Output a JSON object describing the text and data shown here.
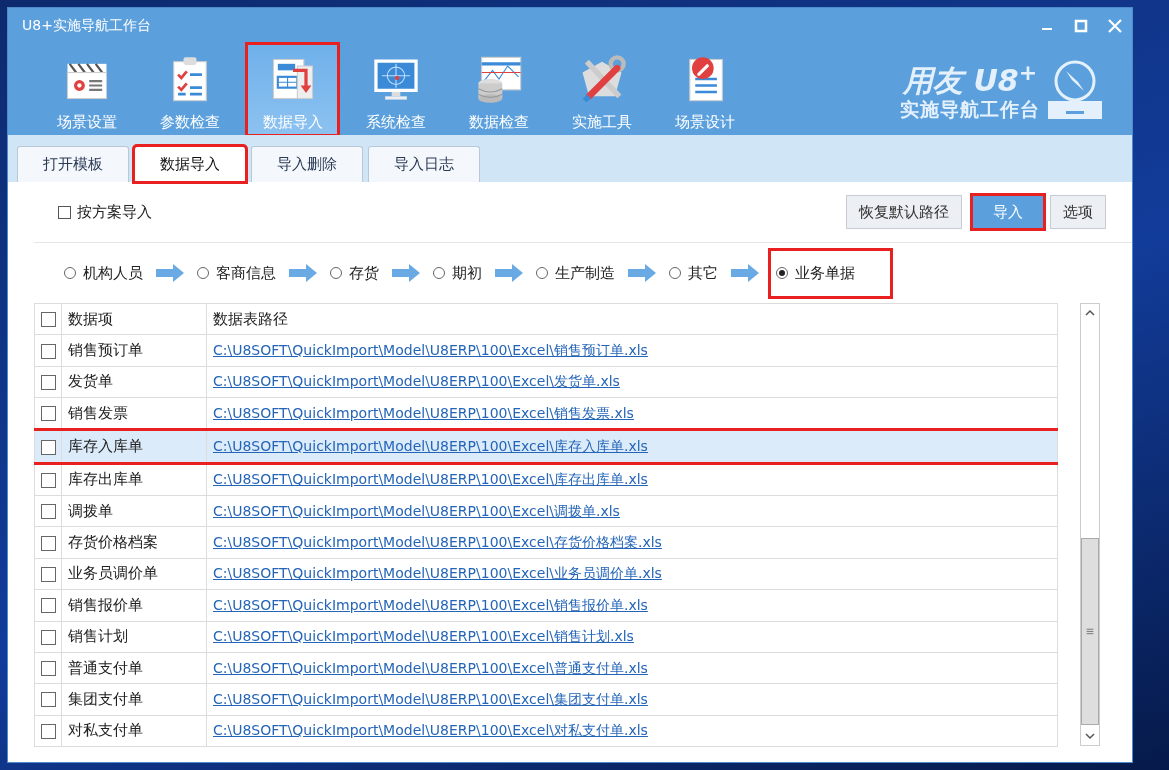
{
  "window": {
    "title": "U8+实施导航工作台"
  },
  "toolbar": [
    {
      "label": "场景设置",
      "selected": false,
      "marked": false
    },
    {
      "label": "参数检查",
      "selected": false,
      "marked": false
    },
    {
      "label": "数据导入",
      "selected": true,
      "marked": true
    },
    {
      "label": "系统检查",
      "selected": false,
      "marked": false
    },
    {
      "label": "数据检查",
      "selected": false,
      "marked": false
    },
    {
      "label": "实施工具",
      "selected": false,
      "marked": false
    },
    {
      "label": "场景设计",
      "selected": false,
      "marked": false
    }
  ],
  "logo": {
    "brand": "用友 U8$^{+}$",
    "subtitle": "实施导航工作台"
  },
  "tabs": [
    {
      "label": "打开模板",
      "selected": false,
      "marked": false
    },
    {
      "label": "数据导入",
      "selected": true,
      "marked": true
    },
    {
      "label": "导入删除",
      "selected": false,
      "marked": false
    },
    {
      "label": "导入日志",
      "selected": false,
      "marked": false
    }
  ],
  "scheme_import": {
    "label": "按方案导入",
    "checked": false
  },
  "buttons": [
    {
      "label": "恢复默认路径",
      "kind": "normal",
      "marked": false
    },
    {
      "label": "导入",
      "kind": "primary",
      "marked": true
    },
    {
      "label": "选项",
      "kind": "normal",
      "marked": false
    }
  ],
  "steps": [
    {
      "label": "机构人员",
      "selected": false,
      "marked": false
    },
    {
      "label": "客商信息",
      "selected": false,
      "marked": false
    },
    {
      "label": "存货",
      "selected": false,
      "marked": false
    },
    {
      "label": "期初",
      "selected": false,
      "marked": false
    },
    {
      "label": "生产制造",
      "selected": false,
      "marked": false
    },
    {
      "label": "其它",
      "selected": false,
      "marked": false
    },
    {
      "label": "业务单据",
      "selected": true,
      "marked": true
    }
  ],
  "table": {
    "columns": [
      "数据项",
      "数据表路径"
    ],
    "header_checked": false,
    "rows": [
      {
        "item": "销售预订单",
        "path": "C:\\U8SOFT\\QuickImport\\Model\\U8ERP\\100\\Excel\\销售预订单.xls",
        "checked": false,
        "selected": false,
        "marked": false
      },
      {
        "item": "发货单",
        "path": "C:\\U8SOFT\\QuickImport\\Model\\U8ERP\\100\\Excel\\发货单.xls",
        "checked": false,
        "selected": false,
        "marked": false
      },
      {
        "item": "销售发票",
        "path": "C:\\U8SOFT\\QuickImport\\Model\\U8ERP\\100\\Excel\\销售发票.xls",
        "checked": false,
        "selected": false,
        "marked": false
      },
      {
        "item": "库存入库单",
        "path": "C:\\U8SOFT\\QuickImport\\Model\\U8ERP\\100\\Excel\\库存入库单.xls",
        "checked": false,
        "selected": true,
        "marked": true
      },
      {
        "item": "库存出库单",
        "path": "C:\\U8SOFT\\QuickImport\\Model\\U8ERP\\100\\Excel\\库存出库单.xls",
        "checked": false,
        "selected": false,
        "marked": false
      },
      {
        "item": "调拨单",
        "path": "C:\\U8SOFT\\QuickImport\\Model\\U8ERP\\100\\Excel\\调拨单.xls",
        "checked": false,
        "selected": false,
        "marked": false
      },
      {
        "item": "存货价格档案",
        "path": "C:\\U8SOFT\\QuickImport\\Model\\U8ERP\\100\\Excel\\存货价格档案.xls",
        "checked": false,
        "selected": false,
        "marked": false
      },
      {
        "item": "业务员调价单",
        "path": "C:\\U8SOFT\\QuickImport\\Model\\U8ERP\\100\\Excel\\业务员调价单.xls",
        "checked": false,
        "selected": false,
        "marked": false
      },
      {
        "item": "销售报价单",
        "path": "C:\\U8SOFT\\QuickImport\\Model\\U8ERP\\100\\Excel\\销售报价单.xls",
        "checked": false,
        "selected": false,
        "marked": false
      },
      {
        "item": "销售计划",
        "path": "C:\\U8SOFT\\QuickImport\\Model\\U8ERP\\100\\Excel\\销售计划.xls",
        "checked": false,
        "selected": false,
        "marked": false
      },
      {
        "item": "普通支付单",
        "path": "C:\\U8SOFT\\QuickImport\\Model\\U8ERP\\100\\Excel\\普通支付单.xls",
        "checked": false,
        "selected": false,
        "marked": false
      },
      {
        "item": "集团支付单",
        "path": "C:\\U8SOFT\\QuickImport\\Model\\U8ERP\\100\\Excel\\集团支付单.xls",
        "checked": false,
        "selected": false,
        "marked": false
      },
      {
        "item": "对私支付单",
        "path": "C:\\U8SOFT\\QuickImport\\Model\\U8ERP\\100\\Excel\\对私支付单.xls",
        "checked": false,
        "selected": false,
        "marked": false
      }
    ]
  }
}
